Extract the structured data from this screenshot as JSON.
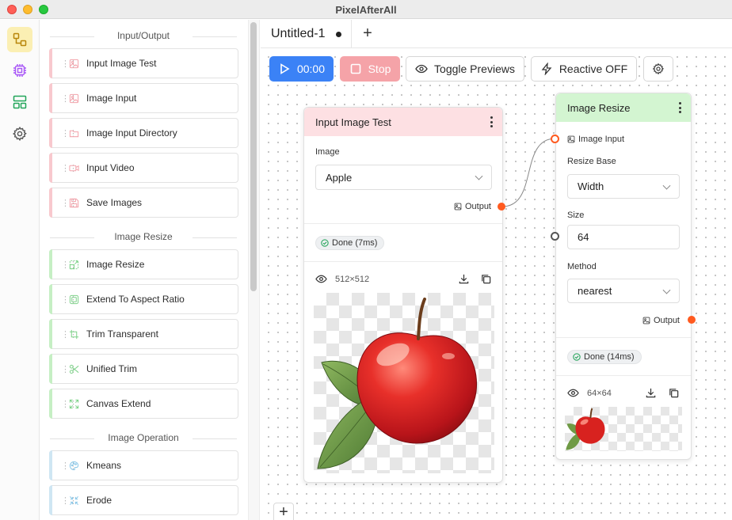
{
  "window": {
    "title": "PixelAfterAll"
  },
  "rail": {
    "items": [
      "nodes-icon",
      "chip-icon",
      "layout-icon",
      "gear-icon"
    ]
  },
  "palette": {
    "sections": [
      {
        "title": "Input/Output",
        "color": "#f8c9ce",
        "items": [
          {
            "label": "Input Image Test",
            "icon": "image-icon"
          },
          {
            "label": "Image Input",
            "icon": "image-icon"
          },
          {
            "label": "Image Input Directory",
            "icon": "folder-icon"
          },
          {
            "label": "Input Video",
            "icon": "video-icon"
          },
          {
            "label": "Save Images",
            "icon": "save-icon"
          }
        ]
      },
      {
        "title": "Image Resize",
        "color": "#c6efc4",
        "items": [
          {
            "label": "Image Resize",
            "icon": "resize-icon"
          },
          {
            "label": "Extend To Aspect Ratio",
            "icon": "frame-icon"
          },
          {
            "label": "Trim Transparent",
            "icon": "crop-icon"
          },
          {
            "label": "Unified Trim",
            "icon": "scissors-icon"
          },
          {
            "label": "Canvas Extend",
            "icon": "expand-icon"
          }
        ]
      },
      {
        "title": "Image Operation",
        "color": "#cfe6f3",
        "items": [
          {
            "label": "Kmeans",
            "icon": "palette-icon"
          },
          {
            "label": "Erode",
            "icon": "shrink-icon"
          }
        ]
      }
    ]
  },
  "tabs": {
    "active": "Untitled-1",
    "unsaved": true,
    "add": "+"
  },
  "toolbar": {
    "run_label": "00:00",
    "stop_label": "Stop",
    "toggle_previews_label": "Toggle Previews",
    "reactive_label": "Reactive OFF"
  },
  "colors": {
    "run": "#3b82f6",
    "stop": "#f5a3a8",
    "input_header": "#fde0e3",
    "resize_header": "#d3f5d1",
    "port": "#ff5a1f",
    "edge": "#8a8a8a"
  },
  "node_input": {
    "title": "Input Image Test",
    "field_label": "Image",
    "field_value": "Apple",
    "output_label": "Output",
    "status": "Done (7ms)",
    "preview_size": "512×512"
  },
  "node_resize": {
    "title": "Image Resize",
    "input_label": "Image Input",
    "base_label": "Resize Base",
    "base_value": "Width",
    "size_label": "Size",
    "size_value": "64",
    "method_label": "Method",
    "method_value": "nearest",
    "output_label": "Output",
    "status": "Done (14ms)",
    "preview_size": "64×64"
  },
  "canvas": {
    "add_label": "+"
  }
}
